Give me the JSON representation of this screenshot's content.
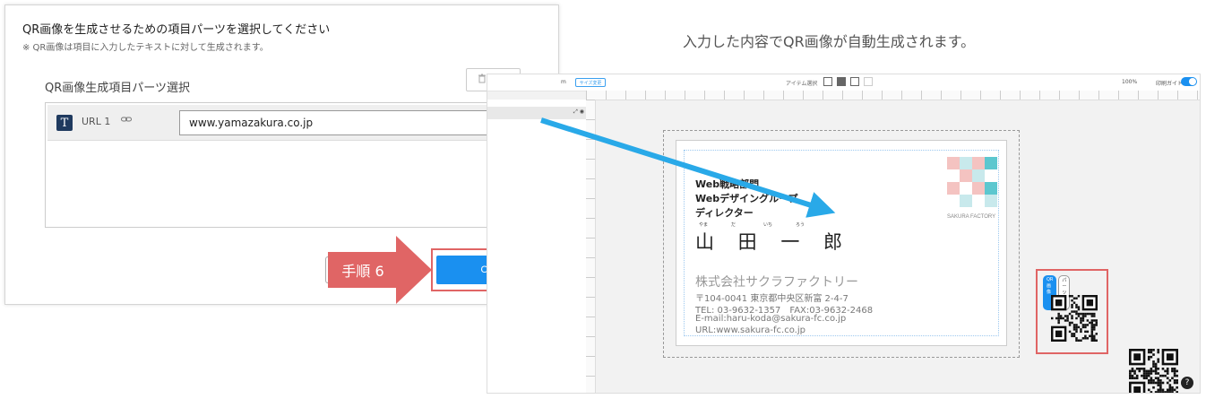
{
  "dialog": {
    "title": "QR画像を生成させるための項目パーツを選択してください",
    "note": "※ QR画像は項目に入力したテキストに対して生成されます。",
    "section_title": "QR画像生成項目パーツ選択",
    "delete_label": "削除",
    "part": {
      "type_icon": "T",
      "name": "URL 1",
      "link_icon": "link-icon",
      "value": "www.yamazakura.co.jp"
    },
    "ok_label": "OK"
  },
  "step_label": "手順 6",
  "caption": "入力した内容でQR画像が自動生成されます。",
  "editor": {
    "unit_label": "m",
    "size_button": "サイズ変更",
    "item_select": "アイテム選択",
    "zoom": "100%",
    "print_guide": "印刷ガイド",
    "toggle_label": "ON",
    "card": {
      "dept1": "Web戦略部門",
      "dept2": "Webデザイングループ",
      "role": "ディレクター",
      "ruby": [
        "やま",
        "だ",
        "いち",
        "ろう"
      ],
      "name": "山 田 一 郎",
      "company": "株式会社サクラファクトリー",
      "address": "〒104-0041 東京都中央区新富 2-4-7",
      "tel": "TEL: 03-9632-1357　FAX:03-9632-2468",
      "email": "E-mail:haru-koda@sakura-fc.co.jp",
      "url": "URL:www.sakura-fc.co.jp",
      "logo_text": "SAKURA FACTORY"
    },
    "qr_tabs": [
      "QR画像",
      "パーツ変更"
    ],
    "help": "?"
  },
  "colors": {
    "primary": "#1a90f0",
    "highlight": "#e06565",
    "arrow": "#29a9e8",
    "logo_pink": "#f4c3c1",
    "logo_teal": "#5cc7cf",
    "logo_light": "#c8e9ec"
  }
}
